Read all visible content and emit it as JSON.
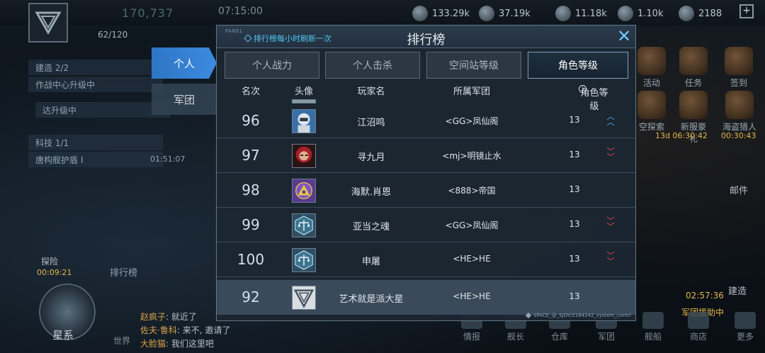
{
  "hud": {
    "power": "170,737",
    "time": "07:15:00",
    "level_progress": "62/120",
    "resources": [
      "133.29k",
      "37.19k",
      "11.18k",
      "1.10k",
      "2188"
    ],
    "left_panels": [
      "建造 2/2",
      "作战中心升级中",
      "达升级中",
      "科技 1/1",
      "唐构舰护盾 I"
    ],
    "left_panel_timer": "01:51:07",
    "right_buttons": [
      "活动",
      "任务",
      "签到",
      "空探索",
      "新服豪礼",
      "海盗猎人"
    ],
    "right_timers": [
      "13d 06:30:42",
      "00:30:43"
    ],
    "mail_label": "邮件",
    "build_label": "建造",
    "build_timer": "02:57:36",
    "bottom_buttons": [
      "情报",
      "舰长",
      "仓库",
      "军团",
      "舰船",
      "商店",
      "更多"
    ],
    "star_label": "星系",
    "world_label": "世界",
    "ranklist_label": "排行榜",
    "explore_label": "探险",
    "explore_timer": "00:09:21",
    "chat": [
      {
        "name": "赵疯子",
        "text": "就近了"
      },
      {
        "name": "佐夫·鲁科",
        "text": "来不, 邀请了"
      },
      {
        "name": "大脸猫",
        "text": "我们这里吧"
      }
    ],
    "defend_label": "军团援助中"
  },
  "side_tabs": [
    "个人",
    "军团"
  ],
  "panel": {
    "tag": "PANEL",
    "refresh_note": "排行榜每小时刷新一次",
    "title": "排行榜",
    "close_icon": "close-icon",
    "footer": "SPACE_@_SJOY/2164242_system_contrl"
  },
  "sub_tabs": [
    "个人战力",
    "个人击杀",
    "空间站等级",
    "角色等级"
  ],
  "columns": [
    "名次",
    "头像",
    "玩家名",
    "所属军团",
    "角色等级"
  ],
  "rows": [
    {
      "rank": "96",
      "avatar": "robot-avatar-icon",
      "name": "江沼鸣",
      "legion": "<GG>凤仙阁",
      "level": "13",
      "trend": "up"
    },
    {
      "rank": "97",
      "avatar": "red-hair-avatar-icon",
      "name": "寻九月",
      "legion": "<mj>明镜止水",
      "level": "13",
      "trend": "down"
    },
    {
      "rank": "98",
      "avatar": "eye-emblem-avatar-icon",
      "name": "海默.肖恩",
      "legion": "<888>帝国",
      "level": "13",
      "trend": "none"
    },
    {
      "rank": "99",
      "avatar": "scales-emblem-avatar-icon",
      "name": "亚当之魂",
      "legion": "<GG>凤仙阁",
      "level": "13",
      "trend": "down"
    },
    {
      "rank": "100",
      "avatar": "scales-emblem-avatar-icon",
      "name": "申屠",
      "legion": "<HE>HE",
      "level": "13",
      "trend": "down"
    }
  ],
  "self_row": {
    "rank": "92",
    "avatar": "triangle-emblem-avatar-icon",
    "name": "艺术就是派大星",
    "legion": "<HE>HE",
    "level": "13"
  },
  "colors": {
    "accent": "#3c8ae0",
    "trend_up": "#37d1f0",
    "trend_down": "#ff4a4a",
    "refresh": "#4ec7f0"
  }
}
